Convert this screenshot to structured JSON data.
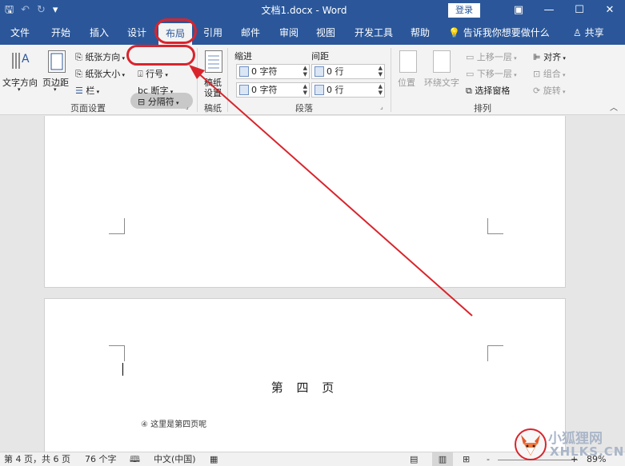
{
  "titlebar": {
    "qat": {
      "save_icon": "save-icon",
      "undo_icon": "undo-icon",
      "redo_icon": "redo-icon",
      "customize_icon": "customize-qat-icon"
    },
    "doc_title": "文档1.docx  -  Word",
    "login_label": "登录",
    "window_controls": [
      "ribbon-display-icon",
      "minimize-icon",
      "maximize-icon",
      "close-icon"
    ]
  },
  "tabs": [
    {
      "label": "文件"
    },
    {
      "label": "开始"
    },
    {
      "label": "插入"
    },
    {
      "label": "设计"
    },
    {
      "label": "布局",
      "active": true
    },
    {
      "label": "引用"
    },
    {
      "label": "邮件"
    },
    {
      "label": "审阅"
    },
    {
      "label": "视图"
    },
    {
      "label": "开发工具"
    },
    {
      "label": "帮助"
    }
  ],
  "tell_me": "告诉我你想要做什么",
  "share": "共享",
  "ribbon": {
    "page_setup": {
      "label": "页面设置",
      "text_direction": "文字方向",
      "margins": "页边距",
      "orientation": "纸张方向",
      "size": "纸张大小",
      "columns": "栏",
      "breaks": "分隔符",
      "line_numbers": "行号",
      "hyphenation": "断字"
    },
    "draft_paper": {
      "label": "稿纸",
      "button_line1": "稿纸",
      "button_line2": "设置"
    },
    "paragraph": {
      "label": "段落",
      "indent_title": "缩进",
      "spacing_title": "间距",
      "indent_left": "0 字符",
      "indent_right": "0 字符",
      "spacing_before": "0 行",
      "spacing_after": "0 行"
    },
    "arrange": {
      "label": "排列",
      "position": "位置",
      "wrap_text": "环绕文字",
      "bring_forward": "上移一层",
      "send_backward": "下移一层",
      "selection_pane": "选择窗格",
      "align": "对齐",
      "group": "组合",
      "rotate": "旋转"
    }
  },
  "document": {
    "page4_heading": "第 四 页",
    "page4_note": "④  这里是第四页呢"
  },
  "status": {
    "page": "第 4 页，共 6 页",
    "words": "76 个字",
    "language": "中文(中国)",
    "zoom": "89%",
    "zoom_minus": "-",
    "zoom_plus": "+"
  },
  "watermark": {
    "line1": "小狐狸网",
    "line2": "XHLKS.CN"
  },
  "colors": {
    "accent": "#2b579a",
    "annotation": "#d9242c"
  }
}
